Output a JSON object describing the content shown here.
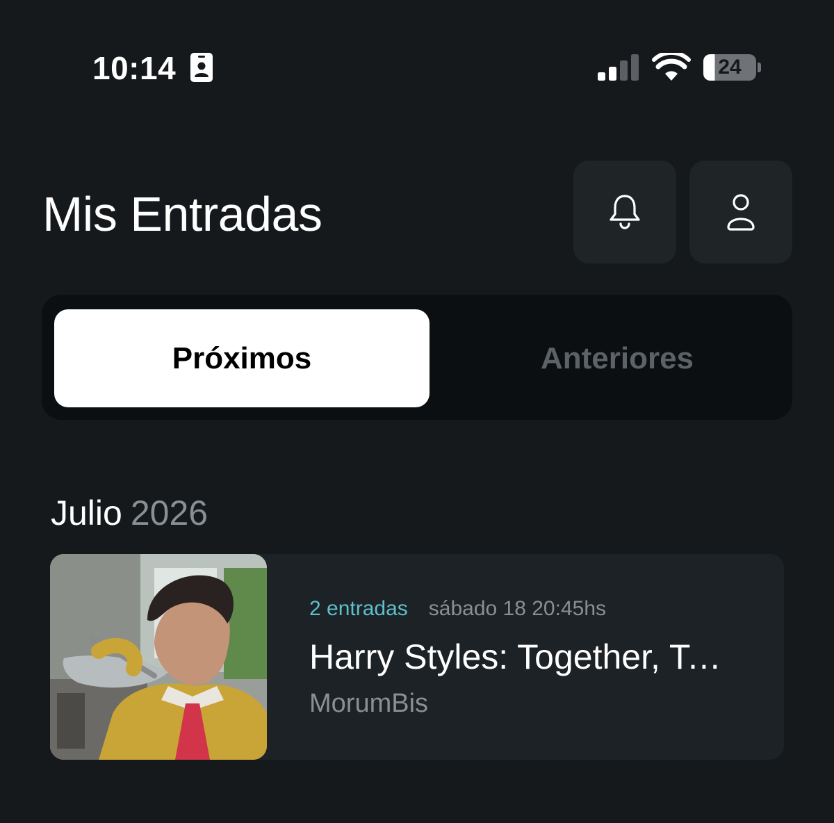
{
  "status_bar": {
    "time": "10:14",
    "battery_level": "24",
    "signal_bars_active": 2,
    "signal_bars_total": 4,
    "battery_fraction": 0.24
  },
  "header": {
    "title": "Mis Entradas",
    "icons": [
      "bell-icon",
      "user-icon"
    ]
  },
  "tabs": [
    {
      "label": "Próximos",
      "selected": true
    },
    {
      "label": "Anteriores",
      "selected": false
    }
  ],
  "section": {
    "month": "Julio",
    "year": "2026"
  },
  "events": [
    {
      "ticket_count": "2 entradas",
      "datetime": "sábado 18 20:45hs",
      "title": "Harry Styles: Together, Together",
      "venue": "MorumBis"
    }
  ],
  "colors": {
    "background": "#15191c",
    "accent": "#5fbfcb",
    "muted_text": "#8a8f93",
    "card": "#1c2226"
  }
}
